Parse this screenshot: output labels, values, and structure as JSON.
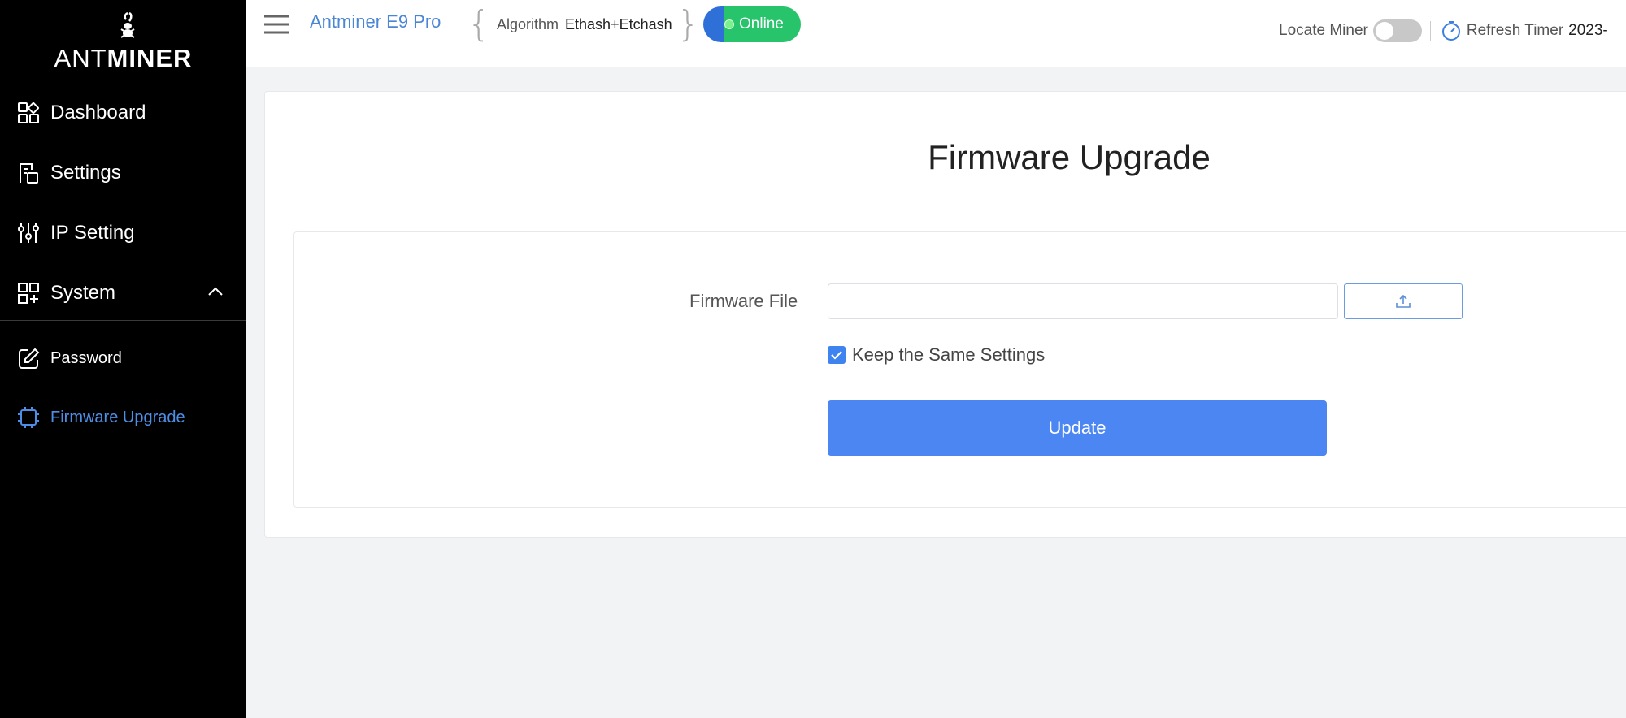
{
  "sidebar": {
    "logo": {
      "part1": "ANT",
      "part2": "MINER"
    },
    "items": [
      {
        "label": "Dashboard",
        "icon": "dashboard-icon"
      },
      {
        "label": "Settings",
        "icon": "settings-icon"
      },
      {
        "label": "IP Setting",
        "icon": "sliders-icon"
      },
      {
        "label": "System",
        "icon": "system-icon",
        "expanded": true
      }
    ],
    "sub_items": [
      {
        "label": "Password",
        "icon": "edit-icon"
      },
      {
        "label": "Firmware Upgrade",
        "icon": "chip-icon",
        "active": true
      }
    ]
  },
  "header": {
    "model": "Antminer E9 Pro",
    "algorithm_label": "Algorithm",
    "algorithm_value": "Ethash+Etchash",
    "status": "Online",
    "locate_label": "Locate Miner",
    "locate_on": false,
    "refresh_label": "Refresh Timer",
    "refresh_value": "2023-"
  },
  "main": {
    "title": "Firmware Upgrade",
    "file_label": "Firmware File",
    "file_value": "",
    "keep_settings_label": "Keep the Same Settings",
    "keep_settings_checked": true,
    "update_label": "Update"
  },
  "colors": {
    "accent": "#4b86f2",
    "sidebar_bg": "#000000",
    "online_green": "#27c46c",
    "active_link": "#4d8fe6"
  }
}
